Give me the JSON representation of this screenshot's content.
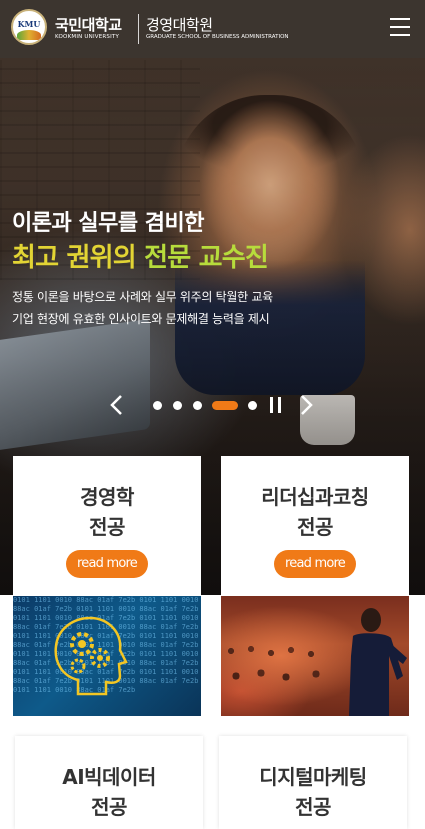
{
  "header": {
    "logo_badge": "KMU",
    "university_ko": "국민대학교",
    "university_en": "KOOKMIN UNIVERSITY",
    "school_ko": "경영대학원",
    "school_en": "GRADUATE SCHOOL OF BUSINESS ADMINISTRATION",
    "menu_icon": "hamburger-menu-icon"
  },
  "hero": {
    "headline_line1": "이론과 실무를 겸비한",
    "headline_line2_part1": "최고 권위의 ",
    "headline_line2_part2": "전문 교수진",
    "description_line1": "정통 이론을 바탕으로 사례와 실무 위주의 탁월한 교육",
    "description_line2": "기업 현장에 유효한 인사이트와 문제해결 능력을 제시",
    "colors": {
      "headline_yellow": "#e2d434",
      "headline_green": "#b7dc3c"
    }
  },
  "slider": {
    "prev_icon": "chevron-left-icon",
    "next_icon": "chevron-right-icon",
    "pause_icon": "pause-icon",
    "slide_count": 5,
    "active_index": 3,
    "active_color": "#f07a17"
  },
  "majors": [
    {
      "title_line1": "경영학",
      "title_line2": "전공",
      "button": "read more"
    },
    {
      "title_line1": "리더십과코칭",
      "title_line2": "전공",
      "button": "read more"
    },
    {
      "title_line1": "AI빅데이터",
      "title_line2": "전공"
    },
    {
      "title_line1": "디지털마케팅",
      "title_line2": "전공"
    }
  ],
  "colors": {
    "accent": "#f07a17",
    "card_title": "#333333"
  }
}
